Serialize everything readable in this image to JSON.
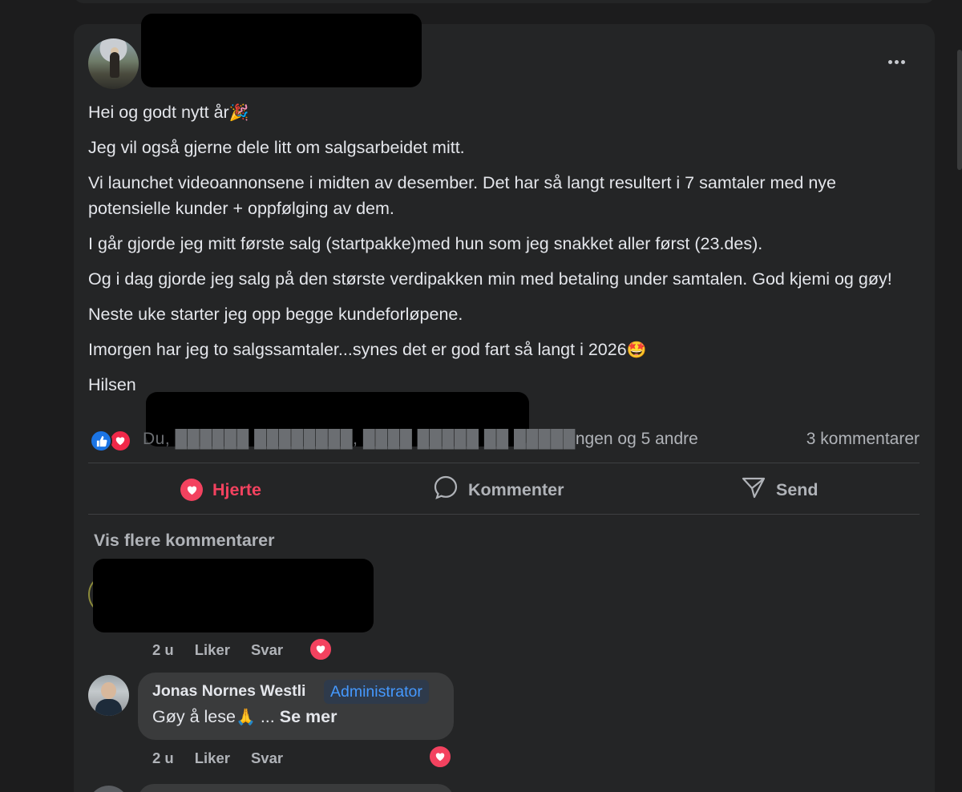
{
  "post": {
    "paragraphs": [
      {
        "text": "Hei og godt nytt år",
        "emoji": "🎉"
      },
      {
        "text": "Jeg vil også gjerne dele litt om salgsarbeidet mitt.",
        "emoji": ""
      },
      {
        "text": "Vi launchet videoannonsene i midten av desember. Det har så langt resultert i 7 samtaler med nye potensielle kunder + oppfølging av dem.",
        "emoji": ""
      },
      {
        "text": "I går gjorde jeg mitt første salg (startpakke)med hun som jeg snakket aller først (23.des).",
        "emoji": ""
      },
      {
        "text": "Og i dag gjorde jeg salg på den største verdipakken min med betaling under samtalen. God kjemi og gøy!",
        "emoji": ""
      },
      {
        "text": "Neste uke starter jeg opp begge kundeforløpene.",
        "emoji": ""
      },
      {
        "text": "Imorgen har jeg to salgssamtaler...synes det er god fart så langt i 2026",
        "emoji": "🤩"
      }
    ],
    "signoff": "Hilsen",
    "more_icon": "ellipsis-icon"
  },
  "reactions": {
    "summary": "Du, Linda Iversen, Nina Hagen og Elisabeth Soelvgen og 5 andre",
    "summary_visible_tail": "ngen og 5 andre",
    "comment_count": "3 kommentarer",
    "icons": [
      "like-icon",
      "love-icon"
    ]
  },
  "actions": {
    "heart": "Hjerte",
    "comment": "Kommenter",
    "send": "Send"
  },
  "comments": {
    "show_more": "Vis flere kommentarer",
    "items": [
      {
        "time": "2 u",
        "like": "Liker",
        "reply": "Svar"
      },
      {
        "author": "Jonas Nornes Westli",
        "badge": "Administrator",
        "text": "Gøy å lese",
        "emoji": "🙏",
        "ellipsis": " ... ",
        "see_more": "Se mer",
        "time": "2 u",
        "like": "Liker",
        "reply": "Svar"
      }
    ]
  },
  "colors": {
    "background": "#1c1c1d",
    "card": "#242526",
    "text": "#e4e6eb",
    "secondary": "#b0b3b8",
    "heart": "#f3425f",
    "like_blue": "#1b74e4",
    "admin_badge": "#4599ff"
  }
}
